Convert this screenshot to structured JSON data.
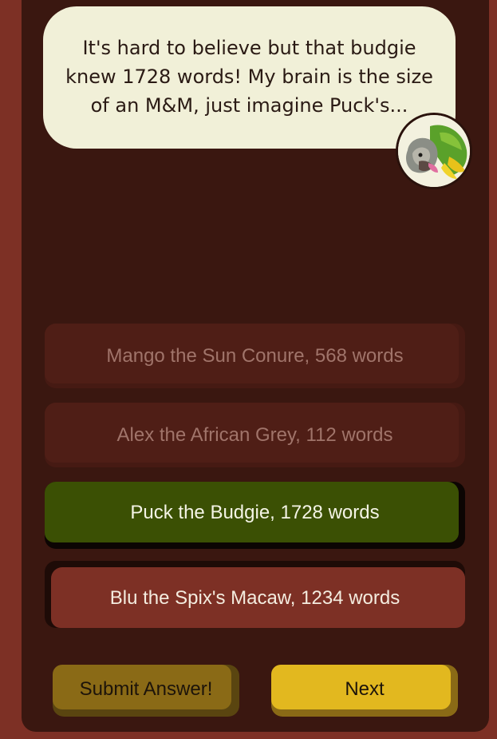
{
  "speech": {
    "text": "It's hard to believe but that budgie knew 1728 words! My brain is the size of an M&M, just imagine Puck's..."
  },
  "avatar": {
    "icon": "parrot-avatar-icon"
  },
  "options": [
    {
      "label": "Mango the Sun Conure, 568 words",
      "state": "disabled"
    },
    {
      "label": "Alex the African Grey, 112 words",
      "state": "disabled"
    },
    {
      "label": "Puck the Budgie, 1728 words",
      "state": "selected"
    },
    {
      "label": "Blu the Spix's Macaw, 1234 words",
      "state": "default"
    }
  ],
  "actions": {
    "submit_label": "Submit Answer!",
    "next_label": "Next"
  },
  "colors": {
    "background": "#7d3025",
    "panel": "#3a1710",
    "bubble": "#f1f0d8",
    "selected": "#3b5004",
    "accent": "#e2b81f"
  }
}
